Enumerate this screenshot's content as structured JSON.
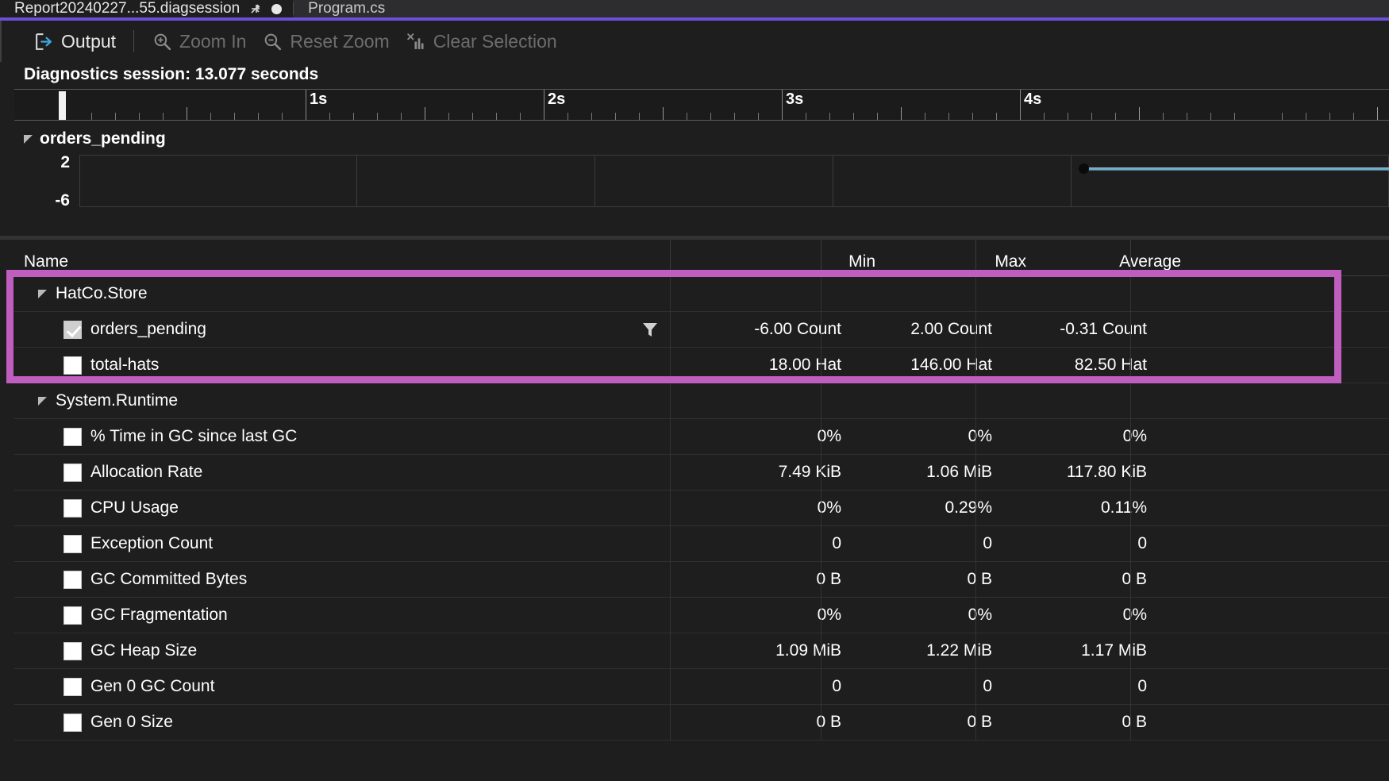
{
  "tabs": [
    {
      "label": "Report20240227...55.diagsession",
      "active": true,
      "pin_icon": "pin-icon",
      "modified_icon": "unsaved-dot-icon"
    },
    {
      "label": "Program.cs",
      "active": false
    }
  ],
  "toolbar": {
    "output_label": "Output",
    "zoom_in_label": "Zoom In",
    "reset_zoom_label": "Reset Zoom",
    "clear_selection_label": "Clear Selection",
    "output_icon": "output-arrow-icon",
    "zoom_in_icon": "magnifier-plus-icon",
    "reset_zoom_icon": "magnifier-minus-icon",
    "clear_selection_icon": "clear-chart-icon"
  },
  "session": {
    "label": "Diagnostics session: 13.077 seconds"
  },
  "ruler": {
    "ticks": [
      "1s",
      "2s",
      "3s",
      "4s"
    ],
    "playhead_position": "0.05s"
  },
  "graph": {
    "title": "orders_pending",
    "expander_icon": "collapse-triangle-icon",
    "y_max": "2",
    "y_min": "-6"
  },
  "chart_data": {
    "type": "line",
    "title": "orders_pending",
    "xlabel": "",
    "ylabel": "",
    "ylim": [
      -6,
      2
    ],
    "xlim": [
      0,
      5.3
    ],
    "xticks": [
      "1s",
      "2s",
      "3s",
      "4s"
    ],
    "yticks": [
      "2",
      "-6"
    ],
    "grid": false,
    "series": [
      {
        "name": "orders_pending",
        "color": "#6fa8c4",
        "x": [
          4.05,
          5.3
        ],
        "y": [
          -0.31,
          -0.31
        ],
        "markers": [
          {
            "x": 4.05,
            "y": -0.31
          }
        ]
      }
    ]
  },
  "table": {
    "columns": [
      "Name",
      "Min",
      "Max",
      "Average"
    ],
    "groups": [
      {
        "name": "HatCo.Store",
        "expander_icon": "collapse-triangle-icon",
        "highlighted": true,
        "rows": [
          {
            "checked": true,
            "name": "orders_pending",
            "min": "-6.00 Count",
            "max": "2.00 Count",
            "average": "-0.31 Count",
            "filter_icon": "filter-funnel-icon"
          },
          {
            "checked": false,
            "name": "total-hats",
            "min": "18.00 Hat",
            "max": "146.00 Hat",
            "average": "82.50 Hat"
          }
        ]
      },
      {
        "name": "System.Runtime",
        "expander_icon": "collapse-triangle-icon",
        "highlighted": false,
        "rows": [
          {
            "checked": false,
            "name": "% Time in GC since last GC",
            "min": "0%",
            "max": "0%",
            "average": "0%"
          },
          {
            "checked": false,
            "name": "Allocation Rate",
            "min": "7.49 KiB",
            "max": "1.06 MiB",
            "average": "117.80 KiB"
          },
          {
            "checked": false,
            "name": "CPU Usage",
            "min": "0%",
            "max": "0.29%",
            "average": "0.11%"
          },
          {
            "checked": false,
            "name": "Exception Count",
            "min": "0",
            "max": "0",
            "average": "0"
          },
          {
            "checked": false,
            "name": "GC Committed Bytes",
            "min": "0 B",
            "max": "0 B",
            "average": "0 B"
          },
          {
            "checked": false,
            "name": "GC Fragmentation",
            "min": "0%",
            "max": "0%",
            "average": "0%"
          },
          {
            "checked": false,
            "name": "GC Heap Size",
            "min": "1.09 MiB",
            "max": "1.22 MiB",
            "average": "1.17 MiB"
          },
          {
            "checked": false,
            "name": "Gen 0 GC Count",
            "min": "0",
            "max": "0",
            "average": "0"
          },
          {
            "checked": false,
            "name": "Gen 0 Size",
            "min": "0 B",
            "max": "0 B",
            "average": "0 B"
          }
        ]
      }
    ]
  },
  "colors": {
    "accent": "#6a4fd8",
    "annotation": "#c05ec0",
    "series": "#6fa8c4",
    "background": "#1e1e1e"
  }
}
